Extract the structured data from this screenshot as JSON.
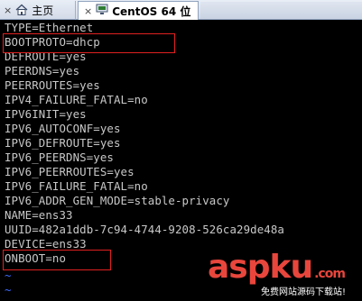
{
  "tabs": {
    "home": "主页",
    "home_close": "×",
    "active": "CentOS 64 位",
    "active_close": "×"
  },
  "terminal": {
    "lines": [
      "TYPE=Ethernet",
      "BOOTPROTO=dhcp",
      "DEFROUTE=yes",
      "PEERDNS=yes",
      "PEERROUTES=yes",
      "IPV4_FAILURE_FATAL=no",
      "IPV6INIT=yes",
      "IPV6_AUTOCONF=yes",
      "IPV6_DEFROUTE=yes",
      "IPV6_PEERDNS=yes",
      "IPV6_PEERROUTES=yes",
      "IPV6_FAILURE_FATAL=no",
      "IPV6_ADDR_GEN_MODE=stable-privacy",
      "NAME=ens33",
      "UUID=482a1ddb-7c94-4744-9208-526ca29de48a",
      "DEVICE=ens33",
      "ONBOOT=no",
      "~",
      "~"
    ]
  },
  "watermark": {
    "brand_asp": "asp",
    "brand_ku": "ku",
    "brand_com": ".com",
    "tagline": "免费网站源码下载站!"
  },
  "colors": {
    "highlight_box": "#e02020",
    "terminal_text": "#c8c8c8",
    "tilde": "#3c6cff",
    "brand": "#e8463c"
  }
}
